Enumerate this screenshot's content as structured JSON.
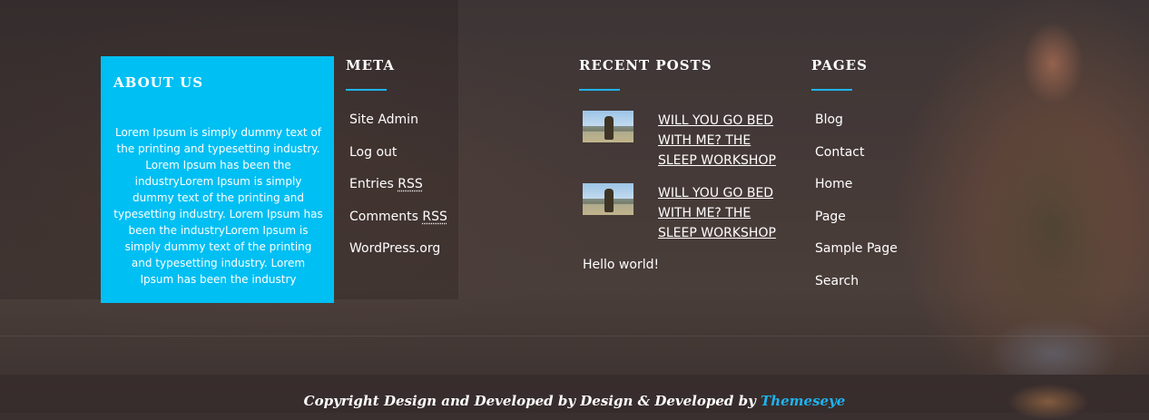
{
  "about": {
    "title": "ABOUT US",
    "text": "Lorem Ipsum is simply dummy text of the printing and typesetting industry. Lorem Ipsum has been the industryLorem Ipsum is simply dummy text of the printing and typesetting industry. Lorem Ipsum has been the industryLorem Ipsum is simply dummy text of the printing and typesetting industry. Lorem Ipsum has been the industry"
  },
  "meta": {
    "title": "META",
    "items": [
      {
        "label": "Site Admin"
      },
      {
        "label": "Log out"
      },
      {
        "label": "Entries ",
        "abbr": "RSS"
      },
      {
        "label": "Comments ",
        "abbr": "RSS"
      },
      {
        "label": "WordPress.org"
      }
    ]
  },
  "recent_posts": {
    "title": "RECENT POSTS",
    "posts": [
      {
        "title": "WILL YOU GO BED WITH ME? THE SLEEP WORKSHOP"
      },
      {
        "title": "WILL YOU GO BED WITH ME? THE SLEEP WORKSHOP"
      }
    ],
    "extra": "Hello world!"
  },
  "pages": {
    "title": "PAGES",
    "items": [
      "Blog",
      "Contact",
      "Home",
      "Page",
      "Sample Page",
      "Search"
    ]
  },
  "footer": {
    "copyright_prefix": "Copyright Design and Developed by Design & Developed by ",
    "brand": "Themeseye"
  },
  "colors": {
    "accent": "#1fb3ef",
    "about_bg": "#00bff3"
  }
}
